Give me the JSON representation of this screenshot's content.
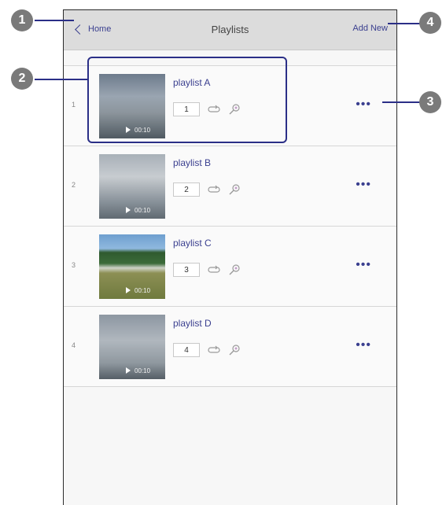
{
  "header": {
    "back_label": "Home",
    "title": "Playlists",
    "add_new_label": "Add New"
  },
  "callouts": [
    "1",
    "2",
    "3",
    "4"
  ],
  "playlists": [
    {
      "index": "1",
      "name": "playlist A",
      "duration": "00:10",
      "count": "1"
    },
    {
      "index": "2",
      "name": "playlist B",
      "duration": "00:10",
      "count": "2"
    },
    {
      "index": "3",
      "name": "playlist C",
      "duration": "00:10",
      "count": "3"
    },
    {
      "index": "4",
      "name": "playlist D",
      "duration": "00:10",
      "count": "4"
    }
  ],
  "more_label": "•••",
  "icons": {
    "back": "chevron-left-icon",
    "play": "play-icon",
    "repeat": "repeat-icon",
    "effect": "effect-wand-icon",
    "more": "more-dots-icon"
  },
  "colors": {
    "accent": "#3a3f8f",
    "highlight": "#2b2f87",
    "navbar": "#dcdcdc",
    "callout": "#7a7a7a"
  }
}
